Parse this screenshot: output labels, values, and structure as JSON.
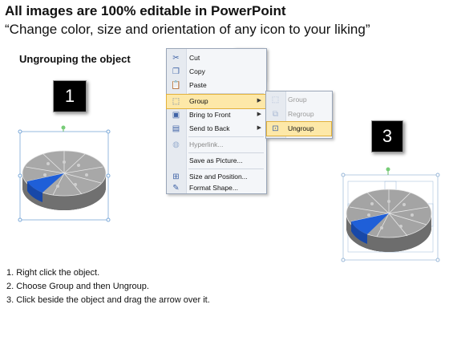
{
  "header": {
    "title": "All images are 100% editable in PowerPoint",
    "subtitle": "“Change color, size and orientation of any icon to your liking”"
  },
  "section_title": "Ungrouping the object",
  "steps": [
    "1",
    "2",
    "3"
  ],
  "context_menu": {
    "items": [
      {
        "label": "Cut",
        "icon": "scissors-icon"
      },
      {
        "label": "Copy",
        "icon": "copy-icon"
      },
      {
        "label": "Paste",
        "icon": "paste-icon"
      },
      {
        "label": "Group",
        "icon": "group-icon",
        "selected": true,
        "submenu": true
      },
      {
        "label": "Bring to Front",
        "icon": "bring-to-front-icon",
        "submenu": true
      },
      {
        "label": "Send to Back",
        "icon": "send-to-back-icon",
        "submenu": true
      },
      {
        "label": "Hyperlink...",
        "icon": "globe-icon",
        "disabled": true
      },
      {
        "label": "Save as Picture...",
        "icon": ""
      },
      {
        "label": "Size and Position...",
        "icon": "size-position-icon"
      },
      {
        "label": "Format Shape...",
        "icon": "format-shape-icon"
      }
    ]
  },
  "submenu": {
    "items": [
      {
        "label": "Group",
        "icon": "group-icon",
        "disabled": true
      },
      {
        "label": "Regroup",
        "icon": "regroup-icon",
        "disabled": true
      },
      {
        "label": "Ungroup",
        "icon": "ungroup-icon",
        "selected": true
      }
    ]
  },
  "instructions": [
    "1.  Right click the object.",
    "2.  Choose Group and then Ungroup.",
    "3.  Click beside the object and drag the arrow over it."
  ],
  "colors": {
    "accent_blue": "#1f5fd8",
    "pie_gray": "#9c9c9c",
    "menu_highlight": "#fde8a8"
  }
}
